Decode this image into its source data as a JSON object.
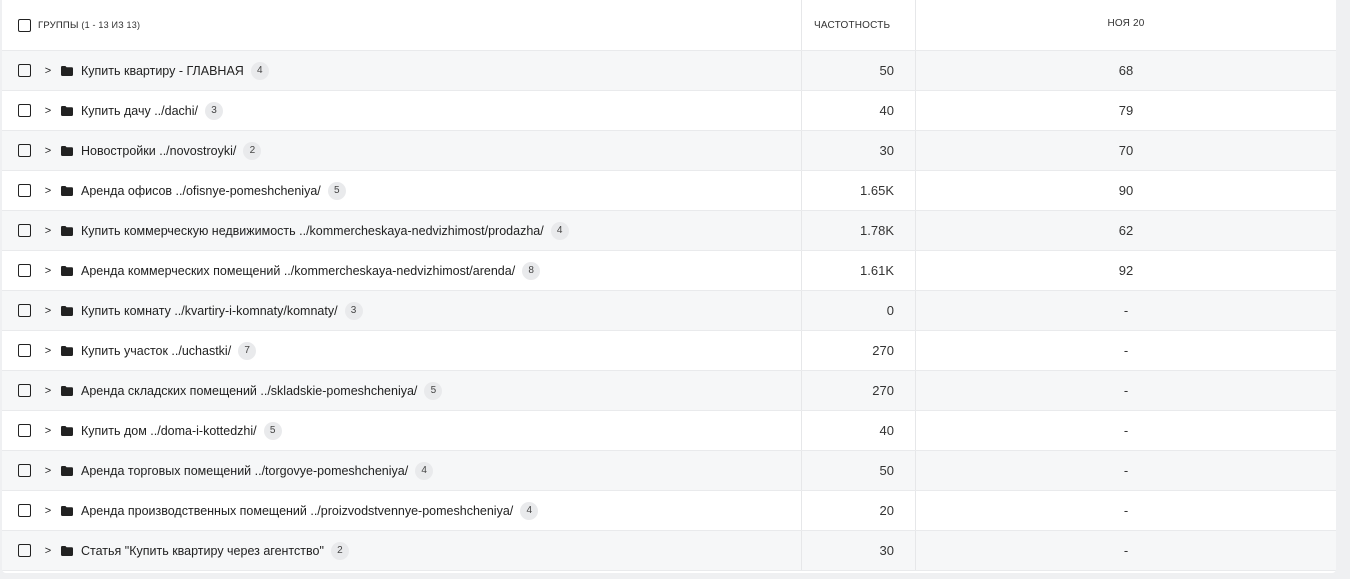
{
  "header": {
    "title": "ГРУППЫ",
    "count": "(1 - 13 ИЗ 13)",
    "col_freq": "ЧАСТОТНОСТЬ",
    "col_nov": "НОЯ 20"
  },
  "rows": [
    {
      "name": "Купить квартиру - ГЛАВНАЯ",
      "count": "4",
      "freq": "50",
      "nov": "68"
    },
    {
      "name": "Купить дачу ../dachi/",
      "count": "3",
      "freq": "40",
      "nov": "79"
    },
    {
      "name": "Новостройки ../novostroyki/",
      "count": "2",
      "freq": "30",
      "nov": "70"
    },
    {
      "name": "Аренда офисов ../ofisnye-pomeshcheniya/",
      "count": "5",
      "freq": "1.65K",
      "nov": "90"
    },
    {
      "name": "Купить коммерческую недвижимость ../kommercheskaya-nedvizhimost/prodazha/",
      "count": "4",
      "freq": "1.78K",
      "nov": "62"
    },
    {
      "name": "Аренда коммерческих помещений ../kommercheskaya-nedvizhimost/arenda/",
      "count": "8",
      "freq": "1.61K",
      "nov": "92"
    },
    {
      "name": "Купить комнату ../kvartiry-i-komnaty/komnaty/",
      "count": "3",
      "freq": "0",
      "nov": "-"
    },
    {
      "name": "Купить участок ../uchastki/",
      "count": "7",
      "freq": "270",
      "nov": "-"
    },
    {
      "name": "Аренда складских помещений ../skladskie-pomeshcheniya/",
      "count": "5",
      "freq": "270",
      "nov": "-"
    },
    {
      "name": "Купить дом ../doma-i-kottedzhi/",
      "count": "5",
      "freq": "40",
      "nov": "-"
    },
    {
      "name": "Аренда торговых помещений ../torgovye-pomeshcheniya/",
      "count": "4",
      "freq": "50",
      "nov": "-"
    },
    {
      "name": "Аренда производственных помещений ../proizvodstvennye-pomeshcheniya/",
      "count": "4",
      "freq": "20",
      "nov": "-"
    },
    {
      "name": "Статья \"Купить квартиру через агентство\"",
      "count": "2",
      "freq": "30",
      "nov": "-"
    }
  ]
}
